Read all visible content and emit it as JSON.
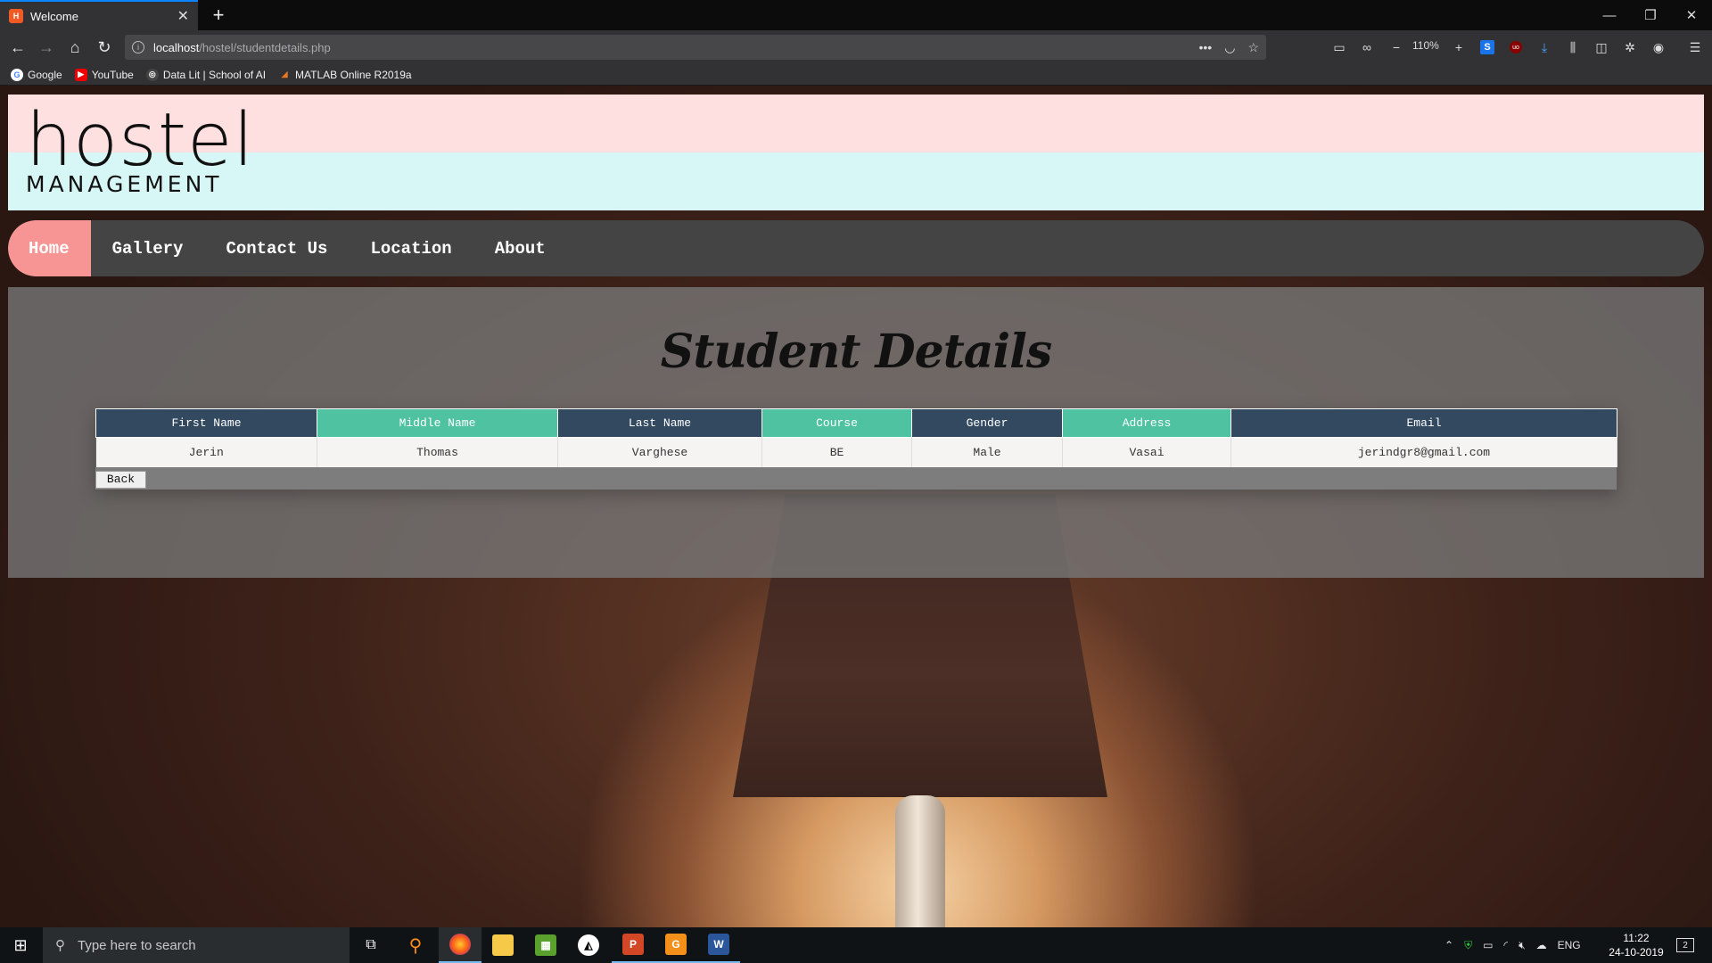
{
  "browser": {
    "tab_title": "Welcome",
    "url_host": "localhost",
    "url_path": "/hostel/studentdetails.php",
    "zoom": "110%",
    "bookmarks": [
      {
        "label": "Google",
        "icon": "google-icon"
      },
      {
        "label": "YouTube",
        "icon": "youtube-icon"
      },
      {
        "label": "Data Lit | School of AI",
        "icon": "school-of-ai-icon"
      },
      {
        "label": "MATLAB Online R2019a",
        "icon": "matlab-icon"
      }
    ]
  },
  "site": {
    "logo": {
      "main": "hostel",
      "sub": "MANAGEMENT"
    },
    "nav": [
      {
        "label": "Home",
        "active": true
      },
      {
        "label": "Gallery",
        "active": false
      },
      {
        "label": "Contact Us",
        "active": false
      },
      {
        "label": "Location",
        "active": false
      },
      {
        "label": "About",
        "active": false
      }
    ],
    "page_title": "Student Details",
    "table": {
      "headers": [
        "First Name",
        "Middle Name",
        "Last Name",
        "Course",
        "Gender",
        "Address",
        "Email"
      ],
      "rows": [
        [
          "Jerin",
          "Thomas",
          "Varghese",
          "BE",
          "Male",
          "Vasai",
          "jerindgr8@gmail.com"
        ]
      ]
    },
    "back_label": "Back",
    "colors": {
      "header_dark": "#324960",
      "header_teal": "#4fc3a1",
      "nav_active": "#f79494",
      "nav_bg": "#444444"
    }
  },
  "taskbar": {
    "search_placeholder": "Type here to search",
    "language": "ENG",
    "time": "11:22",
    "date": "24-10-2019",
    "notification_count": "2"
  }
}
